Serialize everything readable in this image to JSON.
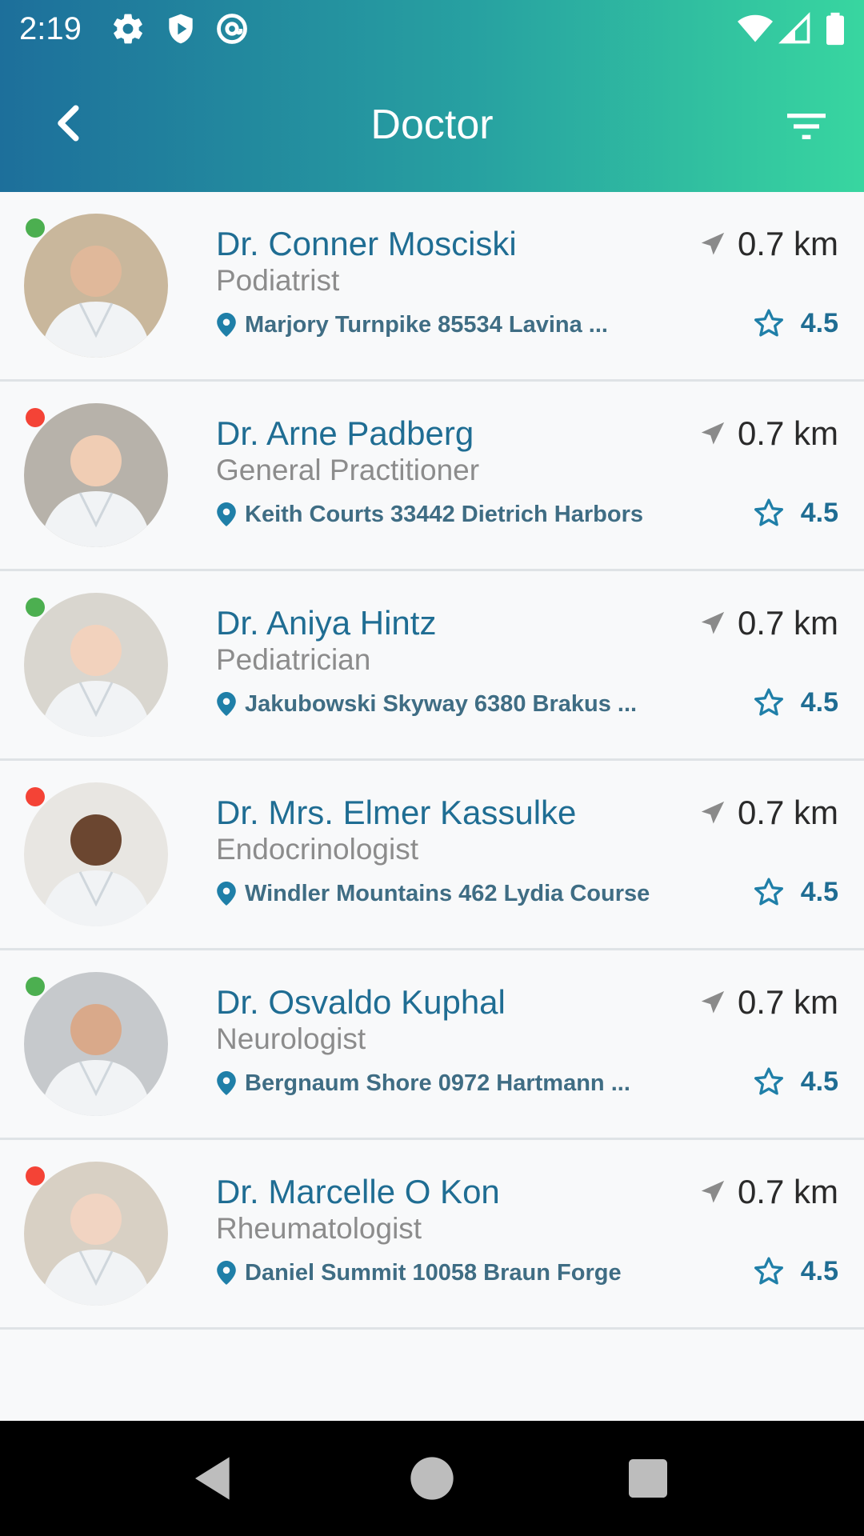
{
  "status_bar": {
    "time": "2:19",
    "icons": [
      "gear-icon",
      "shield-play-icon",
      "at-sign-icon",
      "wifi-icon",
      "signal-icon",
      "battery-icon"
    ]
  },
  "app_bar": {
    "title": "Doctor",
    "back_icon": "chevron-left-icon",
    "filter_icon": "filter-icon"
  },
  "colors": {
    "header_gradient": [
      "#1d6f9b",
      "#27a1a1",
      "#38d6a0"
    ],
    "name_color": "#1f6d93",
    "online": "#4caf50",
    "offline": "#f44336"
  },
  "doctors": [
    {
      "name": "Dr. Conner Mosciski",
      "specialty": "Podiatrist",
      "address": "Marjory Turnpike 85534 Lavina ...",
      "distance": "0.7 km",
      "rating": "4.5",
      "status": "online"
    },
    {
      "name": "Dr. Arne Padberg",
      "specialty": "General Practitioner",
      "address": "Keith Courts 33442 Dietrich Harbors",
      "distance": "0.7 km",
      "rating": "4.5",
      "status": "offline"
    },
    {
      "name": "Dr. Aniya Hintz",
      "specialty": "Pediatrician",
      "address": "Jakubowski Skyway 6380 Brakus ...",
      "distance": "0.7 km",
      "rating": "4.5",
      "status": "online"
    },
    {
      "name": "Dr. Mrs. Elmer Kassulke",
      "specialty": "Endocrinologist",
      "address": "Windler Mountains 462 Lydia Course",
      "distance": "0.7 km",
      "rating": "4.5",
      "status": "offline"
    },
    {
      "name": "Dr. Osvaldo Kuphal",
      "specialty": "Neurologist",
      "address": "Bergnaum Shore 0972 Hartmann ...",
      "distance": "0.7 km",
      "rating": "4.5",
      "status": "online"
    },
    {
      "name": "Dr. Marcelle O Kon",
      "specialty": "Rheumatologist",
      "address": "Daniel Summit 10058 Braun Forge",
      "distance": "0.7 km",
      "rating": "4.5",
      "status": "offline"
    }
  ],
  "system_nav": [
    "back-triangle-icon",
    "home-circle-icon",
    "recents-square-icon"
  ]
}
